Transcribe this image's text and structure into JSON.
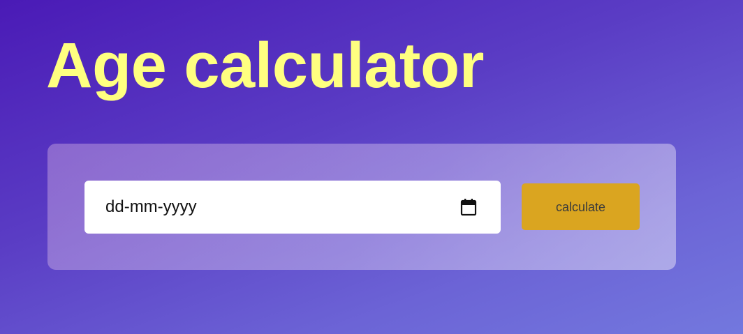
{
  "page": {
    "title": "Age calculator"
  },
  "form": {
    "date_placeholder": "dd-mm-yyyy",
    "calendar_icon": "calendar-icon",
    "calculate_label": "calculate"
  },
  "colors": {
    "title": "#ffff80",
    "button": "#daa520",
    "background_start": "#4a1ab6",
    "background_end": "#7378de"
  }
}
